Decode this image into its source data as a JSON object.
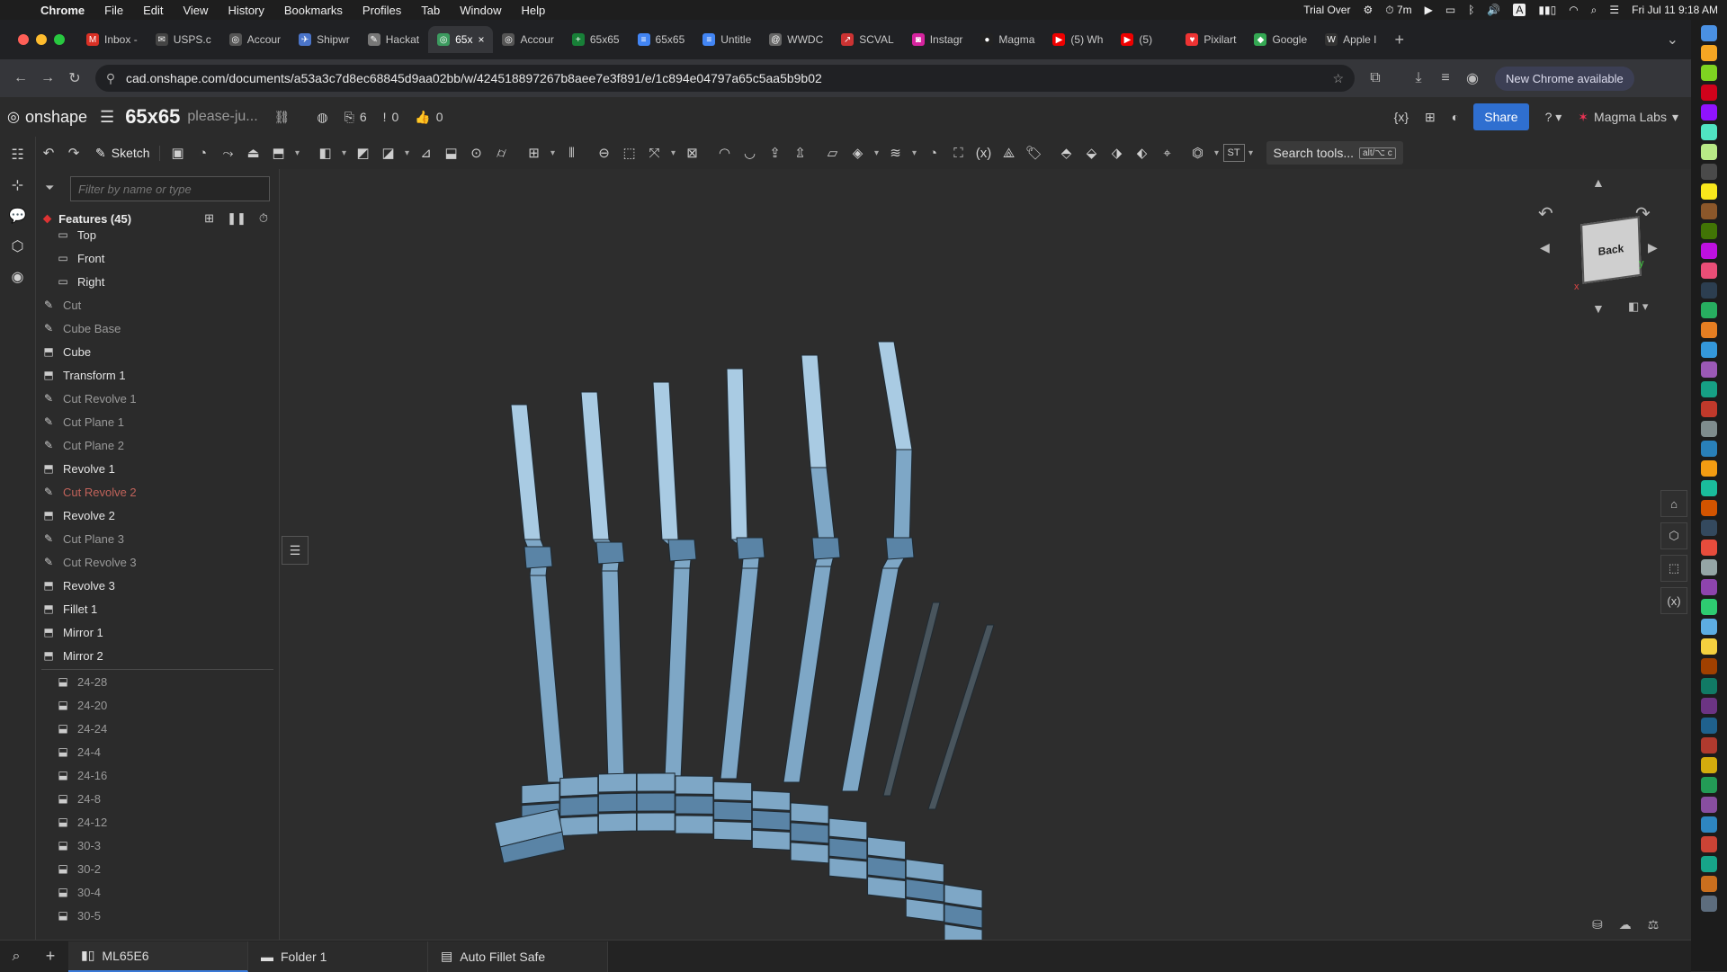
{
  "menubar": {
    "app": "Chrome",
    "items": [
      "File",
      "Edit",
      "View",
      "History",
      "Bookmarks",
      "Profiles",
      "Tab",
      "Window",
      "Help"
    ],
    "status": {
      "trial": "Trial Over",
      "timer": "7m",
      "input": "A",
      "datetime": "Fri Jul 11  9:18 AM"
    }
  },
  "tabs": [
    {
      "label": "Inbox -",
      "color": "#d93025",
      "glyph": "M"
    },
    {
      "label": "USPS.c",
      "color": "#444",
      "glyph": "✉"
    },
    {
      "label": "Accour",
      "color": "#555",
      "glyph": "◎"
    },
    {
      "label": "Shipwr",
      "color": "#4a74c9",
      "glyph": "✈"
    },
    {
      "label": "Hackat",
      "color": "#777",
      "glyph": "✎"
    },
    {
      "label": "65x",
      "color": "#3c9a5f",
      "glyph": "◎",
      "active": true
    },
    {
      "label": "Accour",
      "color": "#555",
      "glyph": "◎"
    },
    {
      "label": "65x65",
      "color": "#188038",
      "glyph": "+"
    },
    {
      "label": "65x65",
      "color": "#4285f4",
      "glyph": "≡"
    },
    {
      "label": "Untitle",
      "color": "#4285f4",
      "glyph": "≡"
    },
    {
      "label": "WWDC",
      "color": "#666",
      "glyph": "@"
    },
    {
      "label": "SCVAL",
      "color": "#c33",
      "glyph": "↗"
    },
    {
      "label": "Instagr",
      "color": "#d6249f",
      "glyph": "◙"
    },
    {
      "label": "Magma",
      "color": "#222",
      "glyph": "●"
    },
    {
      "label": "(5) Wh",
      "color": "#e00",
      "glyph": "▶"
    },
    {
      "label": "(5)",
      "color": "#e00",
      "glyph": "▶"
    },
    {
      "label": "Pixilart",
      "color": "#e33",
      "glyph": "♥"
    },
    {
      "label": "Google",
      "color": "#34a853",
      "glyph": "◆"
    },
    {
      "label": "Apple I",
      "color": "#333",
      "glyph": "W"
    }
  ],
  "url": "cad.onshape.com/documents/a53a3c7d8ec68845d9aa02bb/w/424518897267b8aee7e3f891/e/1c894e04797a65c5aa5b9b02",
  "new_chrome": "New Chrome available",
  "onshape": {
    "brand": "onshape",
    "doc_title": "65x65",
    "doc_sub": "please-ju...",
    "versions": "6",
    "branches": "0",
    "likes": "0",
    "share": "Share",
    "company": "Magma Labs"
  },
  "toolbar": {
    "sketch": "Sketch",
    "search": "Search tools...",
    "shortcut": "alt/⌥ c"
  },
  "features": {
    "filter_placeholder": "Filter by name or type",
    "header": "Features (45)",
    "items": [
      {
        "label": "Top",
        "kind": "plane",
        "cls": "top"
      },
      {
        "label": "Front",
        "kind": "plane",
        "cls": "top"
      },
      {
        "label": "Right",
        "kind": "plane",
        "cls": "top"
      },
      {
        "label": "Cut",
        "kind": "sketch"
      },
      {
        "label": "Cube Base",
        "kind": "sketch"
      },
      {
        "label": "Cube",
        "kind": "feature"
      },
      {
        "label": "Transform 1",
        "kind": "feature"
      },
      {
        "label": "Cut Revolve 1",
        "kind": "sketch"
      },
      {
        "label": "Cut Plane 1",
        "kind": "sketch"
      },
      {
        "label": "Cut Plane 2",
        "kind": "sketch"
      },
      {
        "label": "Revolve 1",
        "kind": "feature"
      },
      {
        "label": "Cut Revolve 2",
        "kind": "err"
      },
      {
        "label": "Revolve 2",
        "kind": "feature"
      },
      {
        "label": "Cut Plane 3",
        "kind": "sketch"
      },
      {
        "label": "Cut Revolve 3",
        "kind": "sketch"
      },
      {
        "label": "Revolve 3",
        "kind": "feature"
      },
      {
        "label": "Fillet 1",
        "kind": "feature"
      },
      {
        "label": "Mirror 1",
        "kind": "feature"
      },
      {
        "label": "Mirror 2",
        "kind": "feature"
      }
    ],
    "parts": [
      "24-28",
      "24-20",
      "24-24",
      "24-4",
      "24-16",
      "24-8",
      "24-12",
      "30-3",
      "30-2",
      "30-4",
      "30-5"
    ]
  },
  "viewcube": {
    "face": "Back",
    "x_axis": "x",
    "y_axis": "y"
  },
  "bottom_tabs": [
    {
      "label": "ML65E6",
      "active": true
    },
    {
      "label": "Folder 1"
    },
    {
      "label": "Auto Fillet Safe"
    }
  ],
  "colors": {
    "part": "#7ea7c6",
    "part_dark": "#5a84a6",
    "edge": "#1e2a33",
    "error": "#c0625a",
    "accent": "#2f6fd0"
  }
}
